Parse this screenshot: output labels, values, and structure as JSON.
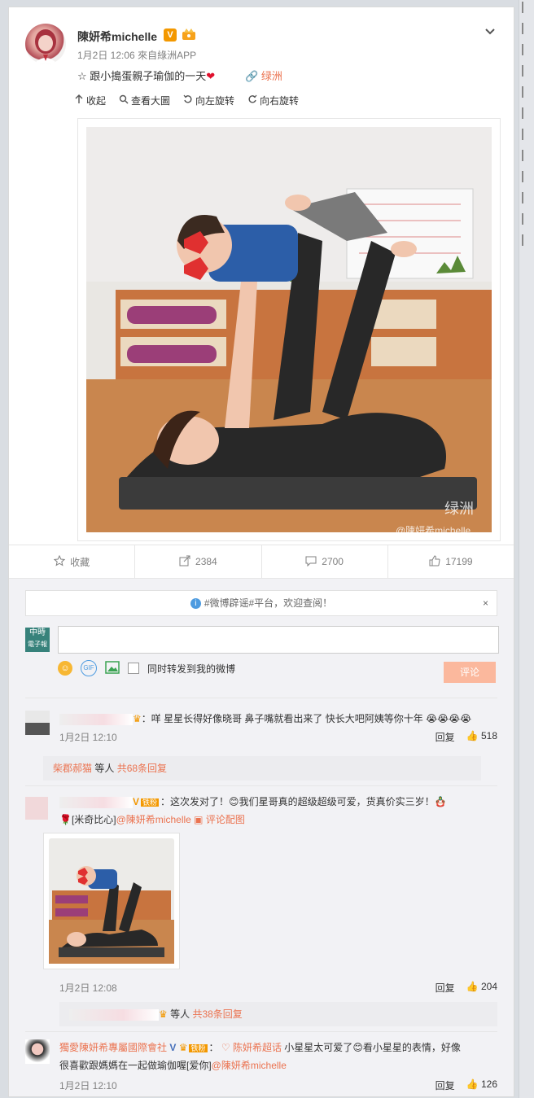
{
  "post": {
    "username": "陳妍希michelle",
    "verified_badge": "V",
    "timestamp": "1月2日 12:06",
    "source": "來自綠洲APP",
    "text": "☆ 跟小搗蛋親子瑜伽的一天",
    "heart": "❤",
    "oasis_link": "绿洲",
    "toolbar": [
      "收起",
      "查看大圖",
      "向左旋转",
      "向右旋转"
    ],
    "watermark_oasis": "绿洲",
    "watermark_user": "@陳妍希michelle"
  },
  "actions": {
    "favorite": "收藏",
    "repost": "2384",
    "comments": "2700",
    "likes": "17199"
  },
  "notice": {
    "text": "#微博辟谣#平台，欢迎查阅！",
    "close": "×"
  },
  "composer": {
    "logo_line1": "中時",
    "logo_line2": "電子報",
    "placeholder": "",
    "repost_option": "同时转发到我的微博",
    "submit": "评论"
  },
  "comments": [
    {
      "text": "：咩 星星长得好像晓哥 鼻子嘴就看出来了 快长大吧阿姨等你十年 😭😭😭😭",
      "time": "1月2日 12:10",
      "reply_label": "回复",
      "likes": "518",
      "replies_user": "柴郡郝猫",
      "replies_mid": " 等人 ",
      "replies_count": "共68条回复"
    },
    {
      "fan_badge": "铁粉",
      "text_a": "：这次发对了！",
      "text_b": "我们星哥真的超级超级可爱，货真价实三岁！",
      "text_c": "[米奇比心]",
      "mention": "@陳妍希michelle",
      "pic_link": "评论配图",
      "time": "1月2日 12:08",
      "reply_label": "回复",
      "likes": "204",
      "replies_mid": " 等人 ",
      "replies_count": "共38条回复"
    },
    {
      "username": "獨愛陳妍希專屬國際會社",
      "verified_badge": "V",
      "fan_badge": "铁粉",
      "topic_link": "陈妍希超话",
      "text_a": " 小星星太可爱了",
      "text_b": "看小星星的表情，好像",
      "text_c": "很喜歡跟媽媽在一起做瑜伽喔[爱你]",
      "mention": "@陳妍希michelle",
      "time": "1月2日 12:10",
      "reply_label": "回复",
      "likes": "126"
    }
  ]
}
